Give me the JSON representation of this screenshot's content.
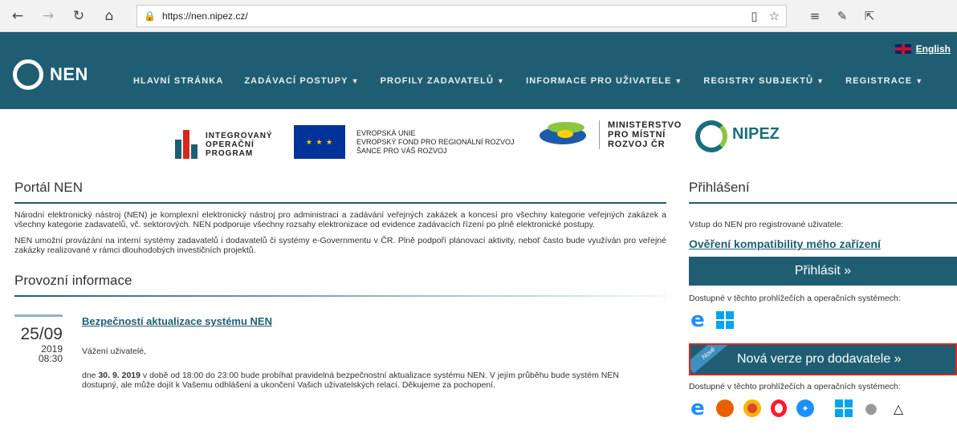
{
  "browser": {
    "back": "←",
    "forward": "→",
    "refresh": "↻",
    "home": "⌂",
    "lock_icon": "lock-icon",
    "url": "https://nen.nipez.cz/",
    "reading_view": "▯",
    "favorite": "☆",
    "favorites_list": "≡",
    "pen": "✎",
    "share": "⇱"
  },
  "header": {
    "logo_text": "NEN",
    "lang_label": "English",
    "menu": [
      {
        "label": "HLAVNÍ STRÁNKA",
        "has_caret": false
      },
      {
        "label": "ZADÁVACÍ POSTUPY",
        "has_caret": true
      },
      {
        "label": "PROFILY ZADAVATELŮ",
        "has_caret": true
      },
      {
        "label": "INFORMACE PRO UŽIVATELE",
        "has_caret": true
      },
      {
        "label": "REGISTRY SUBJEKTŮ",
        "has_caret": true
      },
      {
        "label": "REGISTRACE",
        "has_caret": true
      }
    ]
  },
  "partners": {
    "iop_line1": "INTEGROVANÝ",
    "iop_line2": "OPERAČNÍ",
    "iop_line3": "PROGRAM",
    "eu_line1": "EVROPSKÁ UNIE",
    "eu_line2": "EVROPSKÝ FOND PRO REGIONÁLNÍ ROZVOJ",
    "eu_line3": "ŠANCE PRO VÁŠ ROZVOJ",
    "mmr_line1": "MINISTERSTVO",
    "mmr_line2": "PRO MÍSTNÍ",
    "mmr_line3": "ROZVOJ ČR",
    "nipez": "NIPEZ"
  },
  "portal": {
    "title": "Portál NEN",
    "p1": "Národní elektronický nástroj (NEN) je komplexní elektronický nástroj pro administraci a zadávání veřejných zakázek a koncesí pro všechny kategorie veřejných zakázek a všechny kategorie zadavatelů, vč. sektorových. NEN podporuje všechny rozsahy elektronizace od evidence zadávacích řízení po plně elektronické postupy.",
    "p2": "NEN umožní provázání na interní systémy zadavatelů i dodavatelů či systémy e-Governmentu v ČR. Plně podpoří plánovací aktivity, neboť často bude využíván pro veřejné zakázky realizované v rámci dlouhodobých investičních projektů."
  },
  "provozni": {
    "title": "Provozní informace",
    "news": {
      "date": "25/09",
      "year": "2019",
      "time": "08:30",
      "title": "Bezpečností aktualizace systému NEN",
      "greeting": "Vážení uživatelé,",
      "text_pre": "dne ",
      "text_bold": "30. 9. 2019",
      "text_post": " v době od 18:00 do 23:00 bude probíhat pravidelná bezpečnostní aktualizace systému NEN. V jejím průběhu bude systém NEN dostupný, ale může dojít k Vašemu odhlášení a ukončení Vašich uživatelských relací. Děkujeme za pochopení."
    }
  },
  "sidebar": {
    "title": "Přihlášení",
    "entry_text": "Vstup do NEN pro registrované uživatele:",
    "compat_link": "Ověření kompatibility mého zařízení",
    "login_button": "Přihlásit »",
    "available_text": "Dostupné v těchto prohlížečích a operačních systémech:",
    "new_badge": "Nové",
    "new_version_button": "Nová verze pro dodavatele »",
    "available_text2": "Dostupné v těchto prohlížečích a operačních systémech:"
  }
}
